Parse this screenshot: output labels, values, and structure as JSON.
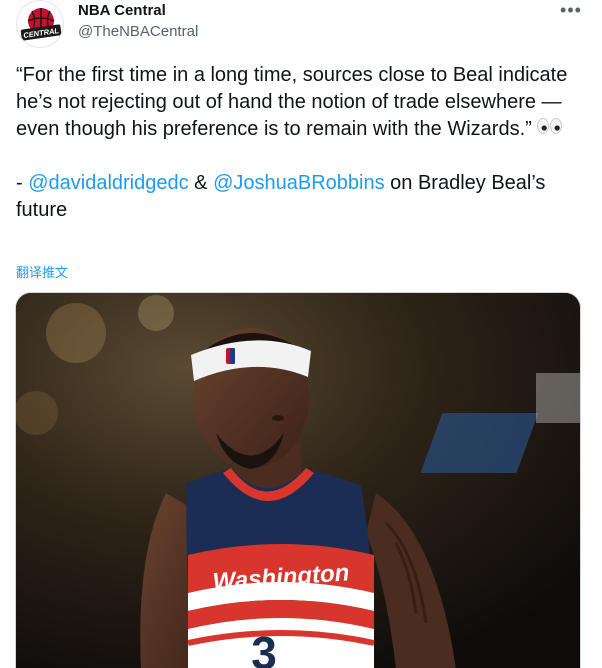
{
  "tweet": {
    "author_name": "NBA Central",
    "author_handle": "@TheNBACentral",
    "avatar_text": "CENTRAL",
    "more_label": "•••",
    "quote": "“For the first time in a long time, sources close to Beal indicate he’s not rejecting out of hand the notion of trade elsewhere — even though his preference is to remain with the Wizards.”",
    "credit_prefix": "- ",
    "mention_1": "@davidaldridgedc",
    "amp": " & ",
    "mention_2": "@JoshuaBRobbins",
    "credit_suffix": " on Bradley Beal’s future",
    "translate_label": "翻译推文"
  },
  "media": {
    "jersey_text": "Washington",
    "jersey_number": "3",
    "colors": {
      "jersey_navy": "#1b2d52",
      "jersey_red": "#d8352c",
      "link_blue": "#1d9bf0"
    }
  }
}
